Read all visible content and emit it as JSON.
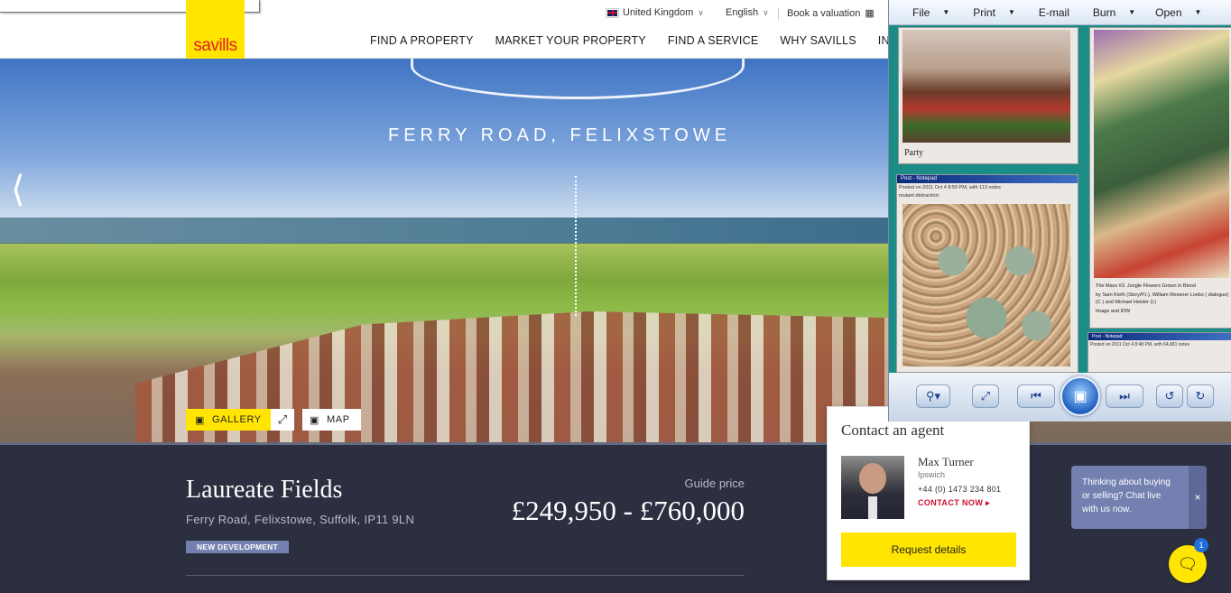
{
  "header": {
    "logo_text": "savills",
    "country": "United Kingdom",
    "language": "English",
    "valuation": "Book a valuation",
    "nav": [
      "FIND A PROPERTY",
      "MARKET YOUR PROPERTY",
      "FIND A SERVICE",
      "WHY SAVILLS",
      "INSIGHT &"
    ]
  },
  "hero": {
    "title": "FERRY ROAD, FELIXSTOWE",
    "gallery_label": "GALLERY",
    "map_label": "MAP"
  },
  "property": {
    "name": "Laureate Fields",
    "address": "Ferry Road, Felixstowe, Suffolk, IP11 9LN",
    "badge": "NEW DEVELOPMENT",
    "guide_label": "Guide price",
    "guide_price": "£249,950 - £760,000"
  },
  "contact": {
    "heading": "Contact an agent",
    "agent_name": "Max Turner",
    "office": "Ipswich",
    "phone": "+44 (0) 1473 234 801",
    "contact_now": "CONTACT NOW",
    "request_label": "Request details"
  },
  "chat": {
    "message": "Thinking about buying or selling? Chat live with us now.",
    "close": "×",
    "unread_count": "1"
  },
  "viewer": {
    "menu": [
      {
        "label": "File",
        "has_dropdown": true
      },
      {
        "label": "Print",
        "has_dropdown": true
      },
      {
        "label": "E-mail",
        "has_dropdown": false
      },
      {
        "label": "Burn",
        "has_dropdown": true
      },
      {
        "label": "Open",
        "has_dropdown": true
      }
    ],
    "tile_muppets_caption": "Party",
    "notepad_title": "Post - Notepad",
    "notepad_posted": "Posted on 2011 Oct 4 8:59 PM, with 113 notes",
    "notepad_text": "mutant-distraction:",
    "comic_caption_1": "The Maxx #3. Jungle Flowers Grown in Blood",
    "comic_caption_2": "by Sam Kieth (Story/P.I.), William Messner Loebs ( dialogue)",
    "comic_caption_3": "(C ) and Michael Heisler (L)",
    "comic_caption_4": "Image and IDW",
    "notepad2_title": "Post - Notepad",
    "notepad2_posted": "Posted on 2011 Oct 4 8:48 PM, with 64,681 notes"
  }
}
